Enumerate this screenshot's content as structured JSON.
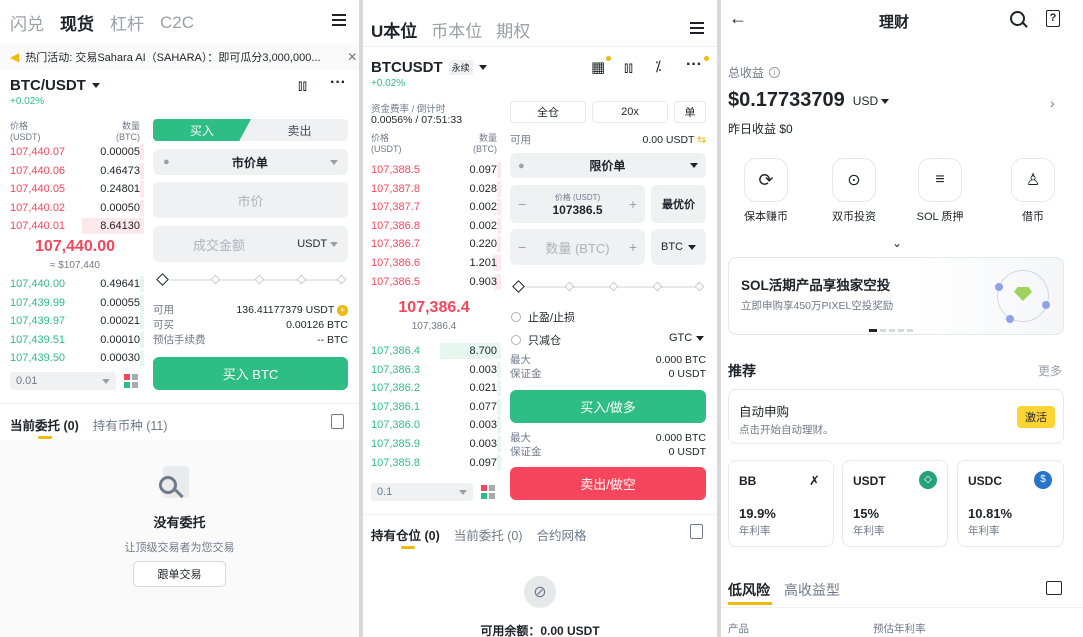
{
  "p1": {
    "tabs": [
      "闪兑",
      "现货",
      "杠杆",
      "C2C"
    ],
    "banner": "热门活动: 交易Sahara AI（SAHARA）：即可瓜分3,000,000...",
    "pair": "BTC/USDT",
    "change": "+0.02%",
    "ob_h_price": "价格",
    "ob_h_price_unit": "(USDT)",
    "ob_h_qty": "数量",
    "ob_h_qty_unit": "(BTC)",
    "asks": [
      [
        "107,440.07",
        "0.00005"
      ],
      [
        "107,440.06",
        "0.46473"
      ],
      [
        "107,440.05",
        "0.24801"
      ],
      [
        "107,440.02",
        "0.00050"
      ],
      [
        "107,440.01",
        "8.64130"
      ]
    ],
    "mid": "107,440.00",
    "mid_fiat": "≈ $107,440",
    "bids": [
      [
        "107,440.00",
        "0.49641"
      ],
      [
        "107,439.99",
        "0.00055"
      ],
      [
        "107,439.97",
        "0.00021"
      ],
      [
        "107,439.51",
        "0.00010"
      ],
      [
        "107,439.50",
        "0.00030"
      ]
    ],
    "precision": "0.01",
    "buy": "买入",
    "sell": "卖出",
    "ordertype": "市价单",
    "price_ph": "市价",
    "amount_ph": "成交金额",
    "amount_unit": "USDT",
    "avail_l": "可用",
    "avail_v": "136.41177379 USDT",
    "canbuy_l": "可买",
    "canbuy_v": "0.00126 BTC",
    "fee_l": "预估手续费",
    "fee_v": "-- BTC",
    "buy_btn": "买入 BTC",
    "bottom_tabs": [
      "当前委托 (0)",
      "持有币种 (11)"
    ],
    "empty_title": "没有委托",
    "empty_sub": "让顶级交易者为您交易",
    "copy_btn": "跟单交易"
  },
  "p2": {
    "tabs": [
      "U本位",
      "币本位",
      "期权"
    ],
    "pair": "BTCUSDT",
    "perp": "永续",
    "change": "+0.02%",
    "funding_l": "资金费率 / 倒计时",
    "funding_v": "0.0056% / 07:51:33",
    "ob_h_price": "价格",
    "ob_h_price_unit": "(USDT)",
    "ob_h_qty": "数量",
    "ob_h_qty_unit": "(BTC)",
    "asks": [
      [
        "107,388.5",
        "0.097"
      ],
      [
        "107,387.8",
        "0.028"
      ],
      [
        "107,387.7",
        "0.002"
      ],
      [
        "107,386.8",
        "0.002"
      ],
      [
        "107,386.7",
        "0.220"
      ],
      [
        "107,386.6",
        "1.201"
      ],
      [
        "107,386.5",
        "0.903"
      ]
    ],
    "mid": "107,386.4",
    "mid_sub": "107,386.4",
    "bids": [
      [
        "107,386.4",
        "8.700"
      ],
      [
        "107,386.3",
        "0.003"
      ],
      [
        "107,386.2",
        "0.021"
      ],
      [
        "107,386.1",
        "0.077"
      ],
      [
        "107,386.0",
        "0.003"
      ],
      [
        "107,385.9",
        "0.003"
      ],
      [
        "107,385.8",
        "0.097"
      ]
    ],
    "precision": "0.1",
    "margin_mode": "全仓",
    "leverage": "20x",
    "side_mode": "单",
    "avail_l": "可用",
    "avail_v": "0.00 USDT",
    "ordertype": "限价单",
    "price_label": "价格 (USDT)",
    "price_v": "107386.5",
    "best": "最优价",
    "qty_ph": "数量 (BTC)",
    "qty_unit": "BTC",
    "tpsl": "止盈/止损",
    "reduce": "只减仓",
    "tif": "GTC",
    "max_l": "最大",
    "max_v": "0.000 BTC",
    "margin_l": "保证金",
    "margin_v": "0 USDT",
    "buy_btn": "买入/做多",
    "max2_v": "0.000 BTC",
    "margin2_v": "0 USDT",
    "sell_btn": "卖出/做空",
    "bottom_tabs": [
      "持有仓位 (0)",
      "当前委托 (0)",
      "合约网格"
    ],
    "avail_bottom": "可用余额：0.00 USDT"
  },
  "p3": {
    "title": "理财",
    "total_l": "总收益",
    "total_v": "$0.17733709",
    "currency": "USD",
    "yesterday": "昨日收益 $0",
    "icons": [
      "保本赚币",
      "双币投资",
      "SOL 质押",
      "借币"
    ],
    "promo_title": "SOL活期产品享独家空投",
    "promo_sub": "立即申购享450万PIXEL空投奖励",
    "rec": "推荐",
    "more": "更多",
    "auto_title": "自动申购",
    "auto_sub": "点击开始自动理财。",
    "activate": "激活",
    "cards": [
      {
        "coin": "BB",
        "rate": "19.9%",
        "label": "年利率"
      },
      {
        "coin": "USDT",
        "rate": "15%",
        "label": "年利率"
      },
      {
        "coin": "USDC",
        "rate": "10.81%",
        "label": "年利率"
      }
    ],
    "risk_tabs": [
      "低风险",
      "高收益型"
    ],
    "col1": "产品",
    "col2": "预估年利率"
  }
}
